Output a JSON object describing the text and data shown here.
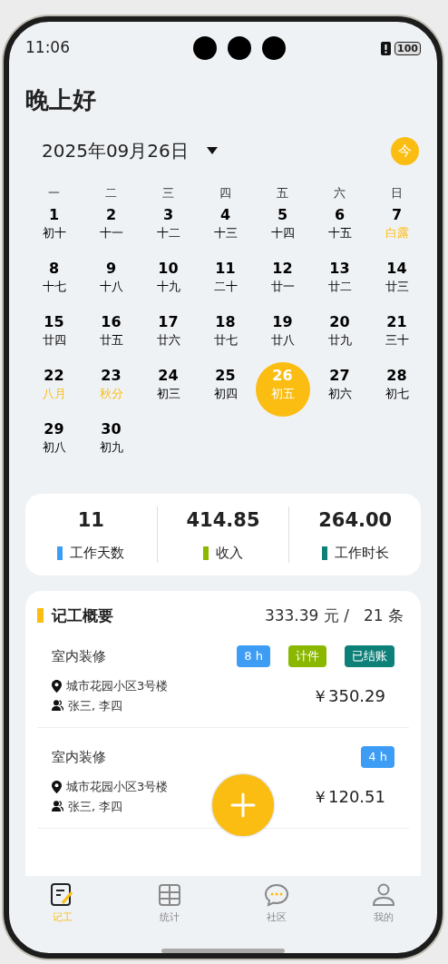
{
  "status_bar": {
    "time": "11:06",
    "battery": "100"
  },
  "greeting": "晚上好",
  "date_picker": {
    "label": "2025年09月26日",
    "today_button": "今"
  },
  "calendar": {
    "weekdays": [
      "一",
      "二",
      "三",
      "四",
      "五",
      "六",
      "日"
    ],
    "days": [
      {
        "day": "1",
        "lunar": "初十",
        "festival": false,
        "selected": false
      },
      {
        "day": "2",
        "lunar": "十一",
        "festival": false,
        "selected": false
      },
      {
        "day": "3",
        "lunar": "十二",
        "festival": false,
        "selected": false
      },
      {
        "day": "4",
        "lunar": "十三",
        "festival": false,
        "selected": false
      },
      {
        "day": "5",
        "lunar": "十四",
        "festival": false,
        "selected": false
      },
      {
        "day": "6",
        "lunar": "十五",
        "festival": false,
        "selected": false
      },
      {
        "day": "7",
        "lunar": "白露",
        "festival": true,
        "selected": false
      },
      {
        "day": "8",
        "lunar": "十七",
        "festival": false,
        "selected": false
      },
      {
        "day": "9",
        "lunar": "十八",
        "festival": false,
        "selected": false
      },
      {
        "day": "10",
        "lunar": "十九",
        "festival": false,
        "selected": false
      },
      {
        "day": "11",
        "lunar": "二十",
        "festival": false,
        "selected": false
      },
      {
        "day": "12",
        "lunar": "廿一",
        "festival": false,
        "selected": false
      },
      {
        "day": "13",
        "lunar": "廿二",
        "festival": false,
        "selected": false
      },
      {
        "day": "14",
        "lunar": "廿三",
        "festival": false,
        "selected": false
      },
      {
        "day": "15",
        "lunar": "廿四",
        "festival": false,
        "selected": false
      },
      {
        "day": "16",
        "lunar": "廿五",
        "festival": false,
        "selected": false
      },
      {
        "day": "17",
        "lunar": "廿六",
        "festival": false,
        "selected": false
      },
      {
        "day": "18",
        "lunar": "廿七",
        "festival": false,
        "selected": false
      },
      {
        "day": "19",
        "lunar": "廿八",
        "festival": false,
        "selected": false
      },
      {
        "day": "20",
        "lunar": "廿九",
        "festival": false,
        "selected": false
      },
      {
        "day": "21",
        "lunar": "三十",
        "festival": false,
        "selected": false
      },
      {
        "day": "22",
        "lunar": "八月",
        "festival": true,
        "selected": false
      },
      {
        "day": "23",
        "lunar": "秋分",
        "festival": true,
        "selected": false
      },
      {
        "day": "24",
        "lunar": "初三",
        "festival": false,
        "selected": false
      },
      {
        "day": "25",
        "lunar": "初四",
        "festival": false,
        "selected": false
      },
      {
        "day": "26",
        "lunar": "初五",
        "festival": false,
        "selected": true
      },
      {
        "day": "27",
        "lunar": "初六",
        "festival": false,
        "selected": false
      },
      {
        "day": "28",
        "lunar": "初七",
        "festival": false,
        "selected": false
      },
      {
        "day": "29",
        "lunar": "初八",
        "festival": false,
        "selected": false
      },
      {
        "day": "30",
        "lunar": "初九",
        "festival": false,
        "selected": false
      }
    ]
  },
  "stats": [
    {
      "value": "11",
      "label": "工作天数",
      "color": "#3d9df5"
    },
    {
      "value": "414.85",
      "label": "收入",
      "color": "#8ab800"
    },
    {
      "value": "264.00",
      "label": "工作时长",
      "color": "#0d8078"
    }
  ],
  "summary": {
    "title": "记工概要",
    "total": "333.39 元 /",
    "count": "21 条",
    "records": [
      {
        "title": "室内装修",
        "tags": [
          {
            "text": "8 h",
            "color": "#3d9df5"
          },
          {
            "text": "计件",
            "color": "#8ab800"
          },
          {
            "text": "已结账",
            "color": "#0d8078"
          }
        ],
        "address": "城市花园小区3号楼",
        "people": "张三, 李四",
        "amount": "￥350.29"
      },
      {
        "title": "室内装修",
        "tags": [
          {
            "text": "4 h",
            "color": "#3d9df5"
          }
        ],
        "address": "城市花园小区3号楼",
        "people": "张三, 李四",
        "amount": "￥120.51"
      }
    ]
  },
  "tab_bar": [
    {
      "label": "记工",
      "kind": "note",
      "selected": true
    },
    {
      "label": "统计",
      "kind": "table",
      "selected": false
    },
    {
      "label": "社区",
      "kind": "chat",
      "selected": false
    },
    {
      "label": "我的",
      "kind": "person",
      "selected": false
    }
  ]
}
